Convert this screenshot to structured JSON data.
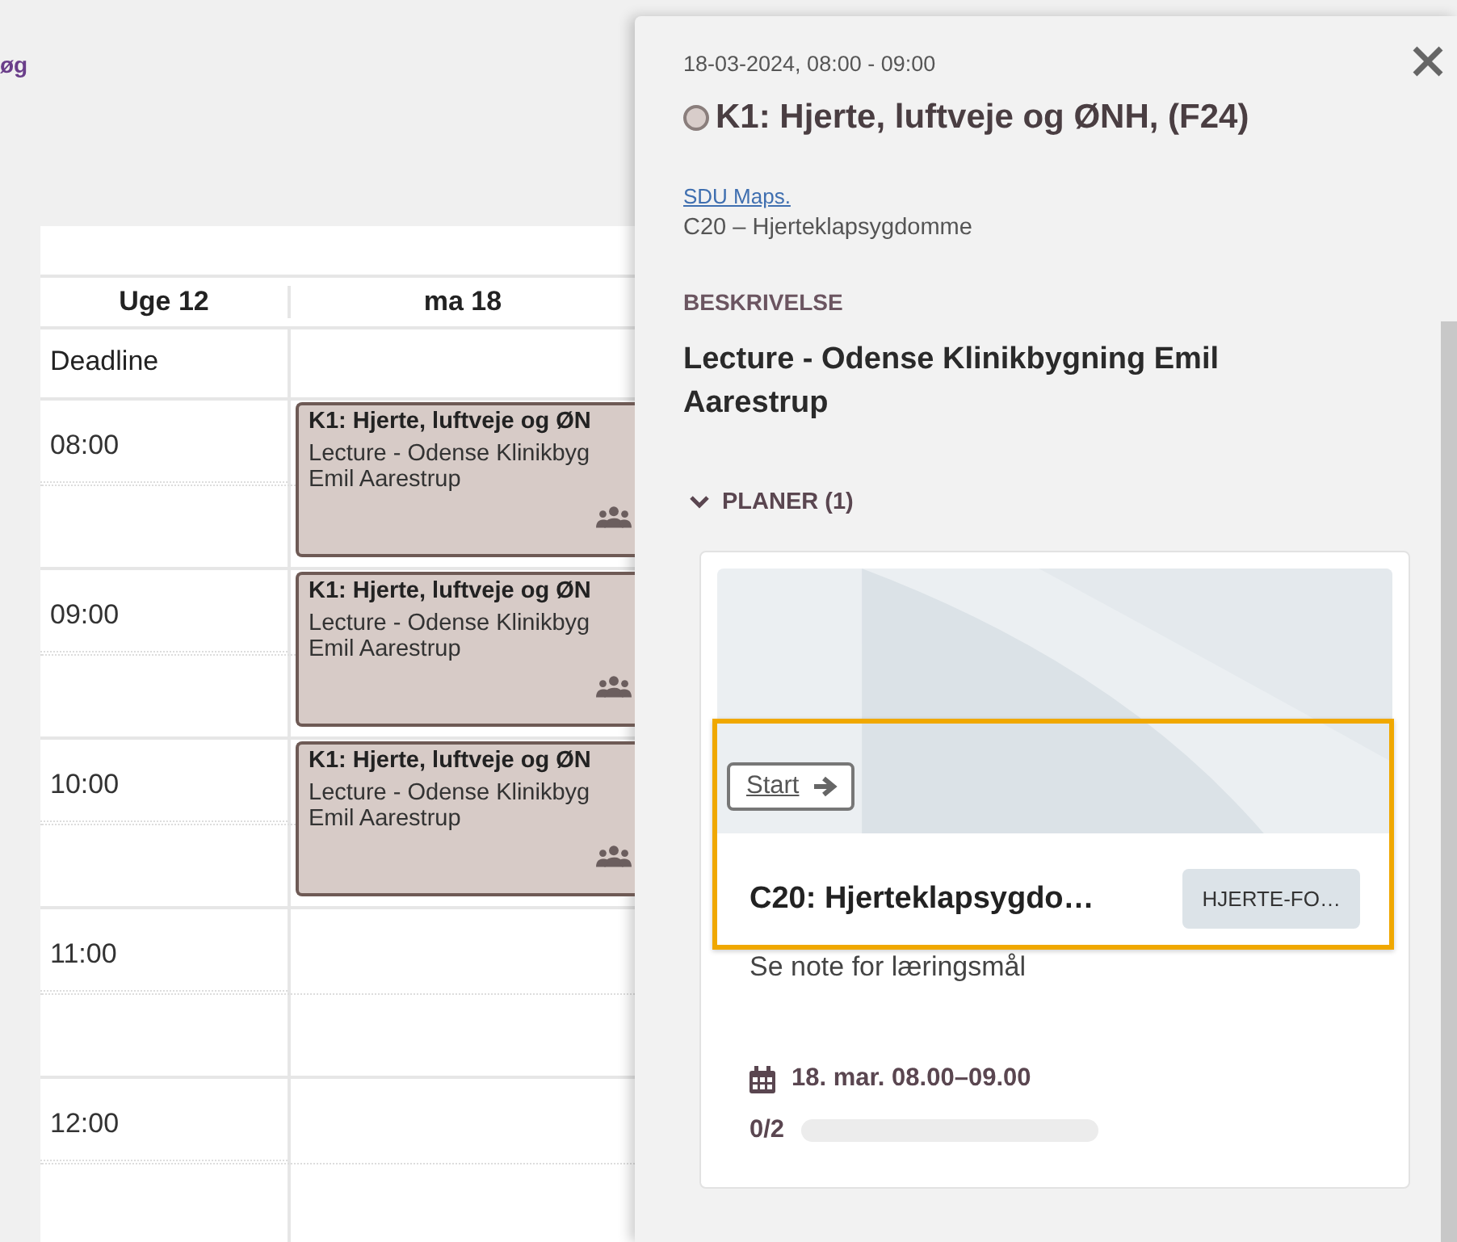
{
  "top_link": "øg",
  "calendar": {
    "week": "Uge 12",
    "day": "ma 18",
    "deadline_label": "Deadline",
    "hours": [
      "08:00",
      "09:00",
      "10:00",
      "11:00",
      "12:00"
    ],
    "events": [
      {
        "title": "K1: Hjerte, luftveje og ØN",
        "location": "Lecture - Odense Klinikbyg",
        "teacher": "Emil Aarestrup"
      },
      {
        "title": "K1: Hjerte, luftveje og ØN",
        "location": "Lecture - Odense Klinikbyg",
        "teacher": "Emil Aarestrup"
      },
      {
        "title": "K1: Hjerte, luftveje og ØN",
        "location": "Lecture - Odense Klinikbyg",
        "teacher": "Emil Aarestrup"
      }
    ]
  },
  "panel": {
    "datetime": "18-03-2024, 08:00 - 09:00",
    "title": "K1: Hjerte, luftveje og ØNH, (F24)",
    "link": "SDU Maps.",
    "topic": "C20 – Hjerteklapsygdomme",
    "section_label": "BESKRIVELSE",
    "description": "Lecture - Odense Klinikbygning Emil Aarestrup",
    "plans_label": "PLANER (1)",
    "plans_expanded": true,
    "plan": {
      "start_label": "Start",
      "title": "C20: Hjerteklapsygdo…",
      "tag": "HJERTE-FO…",
      "note": "Se note for læringsmål",
      "date": "18. mar. 08.00–09.00",
      "progress": "0/2",
      "level": 0,
      "focused": true
    }
  }
}
